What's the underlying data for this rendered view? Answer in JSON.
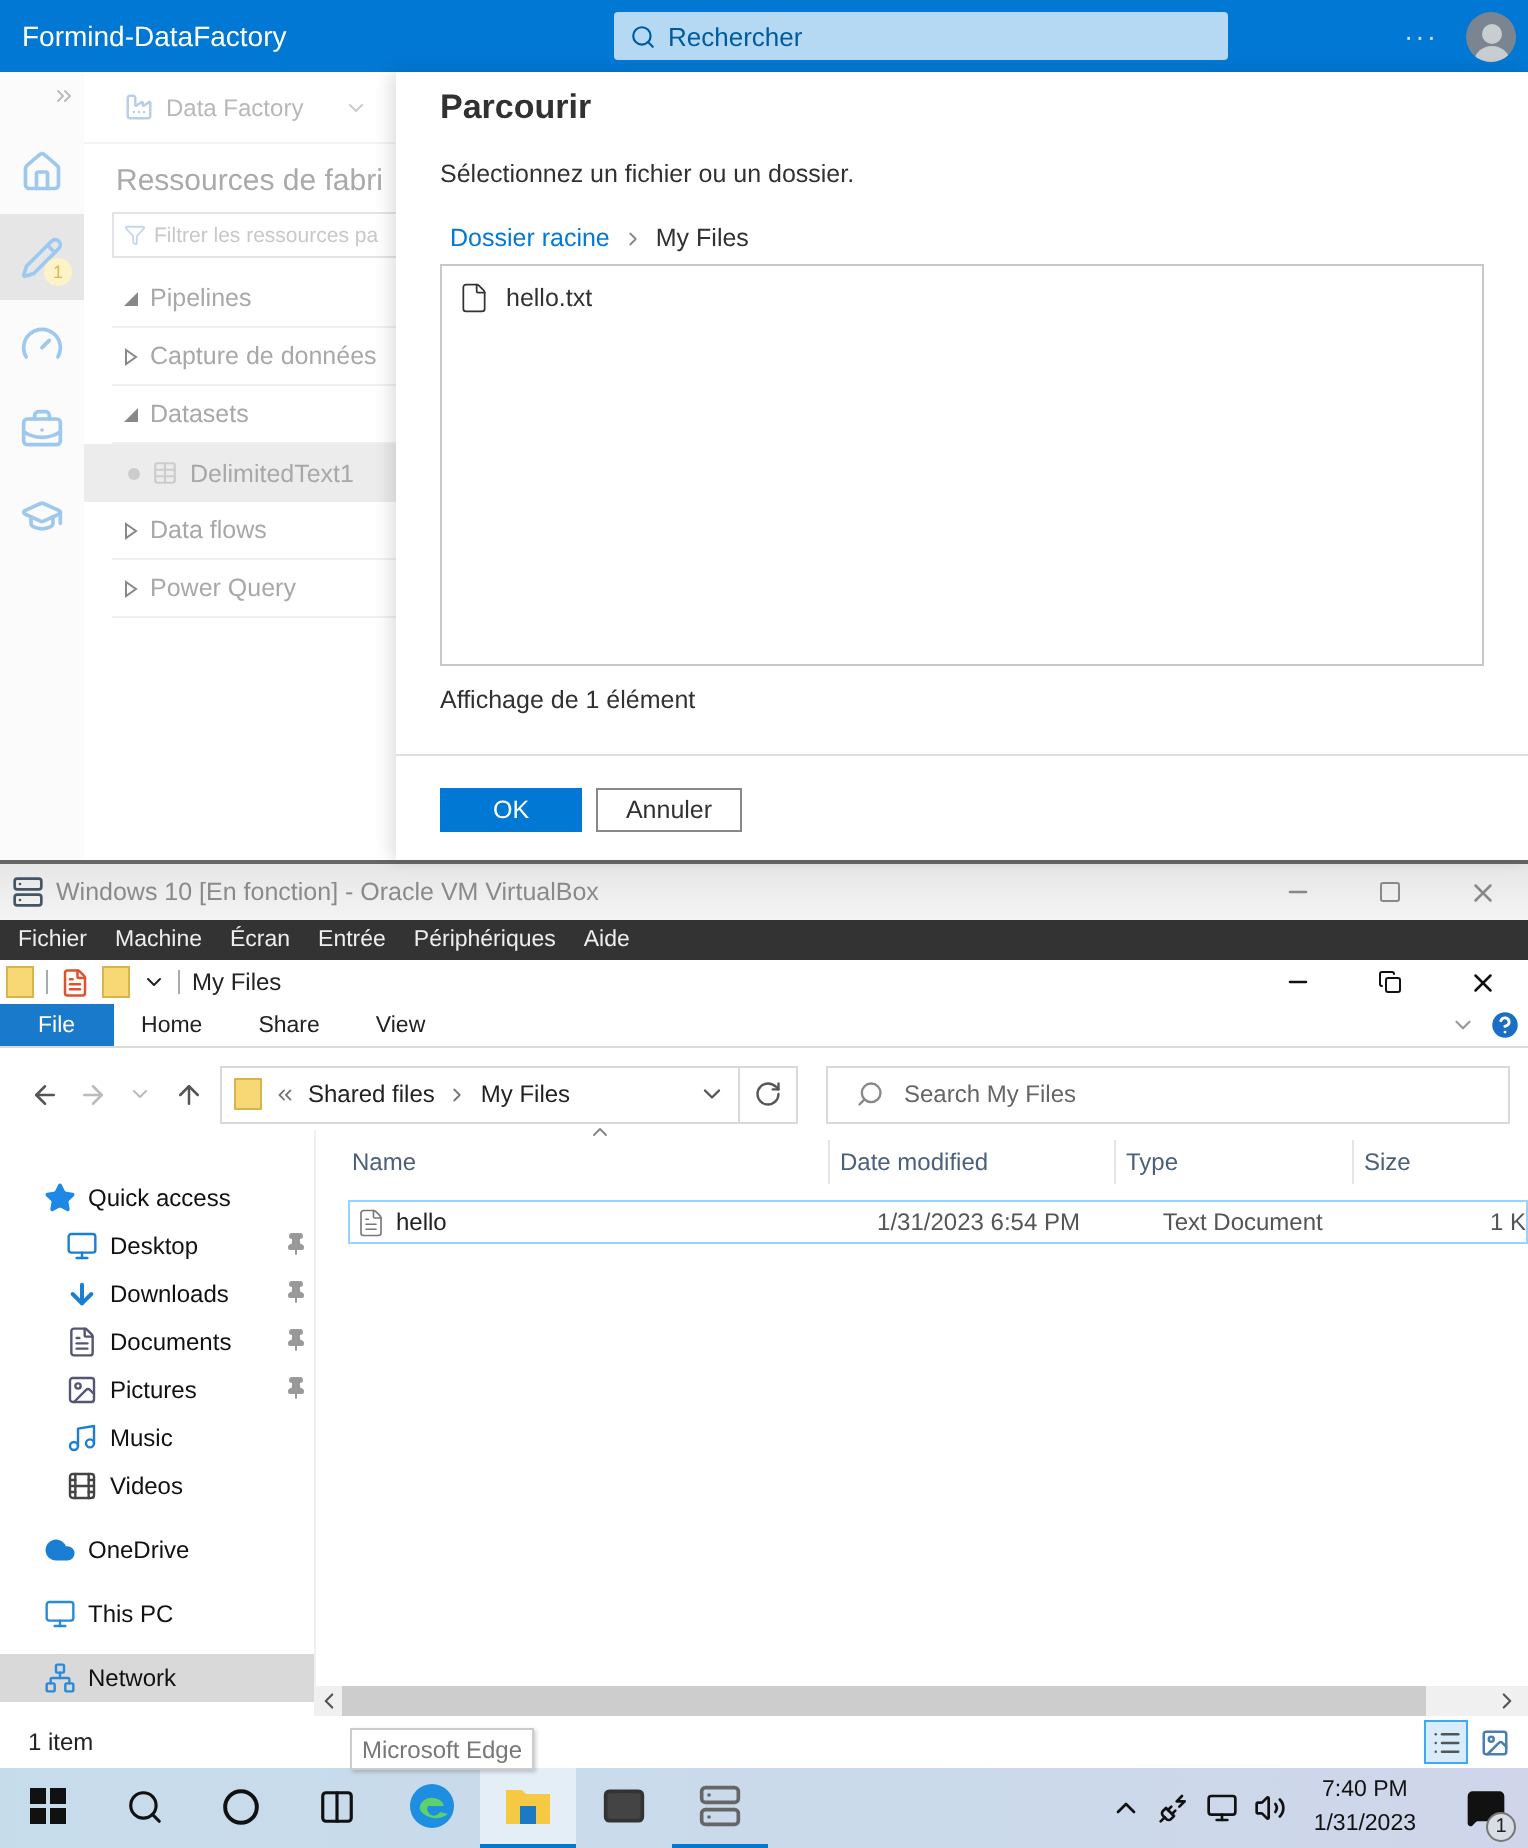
{
  "header": {
    "title": "Formind-DataFactory",
    "search_placeholder": "Rechercher",
    "more": "···"
  },
  "rail": [
    {
      "kind": "home",
      "selected": false
    },
    {
      "kind": "author",
      "selected": true,
      "badge": "1"
    },
    {
      "kind": "monitor",
      "selected": false
    },
    {
      "kind": "manage",
      "selected": false
    },
    {
      "kind": "learn",
      "selected": false
    }
  ],
  "resources": {
    "factory": "Data Factory",
    "title": "Ressources de fabri",
    "filter_placeholder": "Filtrer les ressources pa",
    "tree": [
      {
        "label": "Pipelines",
        "expanded": true,
        "selected": false
      },
      {
        "label": "Capture de données",
        "expanded": false,
        "selected": false
      },
      {
        "label": "Datasets",
        "expanded": true,
        "selected": false,
        "children": [
          {
            "label": "DelimitedText1",
            "selected": true
          }
        ]
      },
      {
        "label": "Data flows",
        "expanded": false,
        "selected": false
      },
      {
        "label": "Power Query",
        "expanded": false,
        "selected": false
      }
    ]
  },
  "dialog": {
    "title": "Parcourir",
    "instruction": "Sélectionnez un fichier ou un dossier.",
    "breadcrumb": [
      {
        "label": "Dossier racine",
        "kind": "link"
      },
      {
        "label": "My Files",
        "kind": "current"
      }
    ],
    "files": [
      {
        "name": "hello.txt"
      }
    ],
    "count": "Affichage de 1 élément",
    "buttons": [
      {
        "label": "OK",
        "primary": true
      },
      {
        "label": "Annuler",
        "primary": false
      }
    ]
  },
  "vm": {
    "title": "Windows 10 [En fonction] - Oracle VM VirtualBox",
    "menu": [
      "Fichier",
      "Machine",
      "Écran",
      "Entrée",
      "Périphériques",
      "Aide"
    ]
  },
  "explorer": {
    "title": "My Files",
    "ribbon_tabs": [
      {
        "label": "File",
        "kind": "file"
      },
      {
        "label": "Home",
        "kind": "tab"
      },
      {
        "label": "Share",
        "kind": "tab"
      },
      {
        "label": "View",
        "kind": "tab"
      }
    ],
    "path": [
      "Shared files",
      "My Files"
    ],
    "search_placeholder": "Search My Files",
    "columns": [
      "Name",
      "Date modified",
      "Type",
      "Size"
    ],
    "files": [
      {
        "name": "hello",
        "date": "1/31/2023 6:54 PM",
        "type": "Text Document",
        "size": "1 K",
        "selected": true
      }
    ],
    "nav": [
      {
        "label": "Quick access",
        "kind": "star",
        "selected": false,
        "children": [
          {
            "label": "Desktop",
            "kind": "desktop",
            "pinned": true,
            "selected": false
          },
          {
            "label": "Downloads",
            "kind": "download",
            "pinned": true,
            "selected": false
          },
          {
            "label": "Documents",
            "kind": "document",
            "pinned": true,
            "selected": false
          },
          {
            "label": "Pictures",
            "kind": "picture",
            "pinned": true,
            "selected": false
          },
          {
            "label": "Music",
            "kind": "music",
            "pinned": false,
            "selected": false
          },
          {
            "label": "Videos",
            "kind": "video",
            "pinned": false,
            "selected": false
          }
        ]
      },
      {
        "label": "OneDrive",
        "kind": "cloud",
        "selected": false
      },
      {
        "label": "This PC",
        "kind": "pc",
        "selected": false
      },
      {
        "label": "Network",
        "kind": "network",
        "selected": true
      }
    ],
    "status": "1 item",
    "views": [
      {
        "kind": "details",
        "selected": true
      },
      {
        "kind": "tiles",
        "selected": false
      }
    ]
  },
  "tooltip": "Microsoft Edge",
  "taskbar": {
    "buttons": [
      {
        "kind": "start"
      },
      {
        "kind": "search"
      },
      {
        "kind": "cortana"
      },
      {
        "kind": "taskview"
      }
    ],
    "apps": [
      {
        "kind": "edge",
        "running": false,
        "selected": false
      },
      {
        "kind": "explorer",
        "running": true,
        "selected": true
      },
      {
        "kind": "mail",
        "running": false,
        "selected": false
      },
      {
        "kind": "server",
        "running": true,
        "selected": false
      }
    ],
    "tray": [
      {
        "kind": "chevron"
      },
      {
        "kind": "power"
      },
      {
        "kind": "network"
      },
      {
        "kind": "volume"
      }
    ],
    "time": "7:40 PM",
    "date": "1/31/2023",
    "notifications": "1"
  }
}
